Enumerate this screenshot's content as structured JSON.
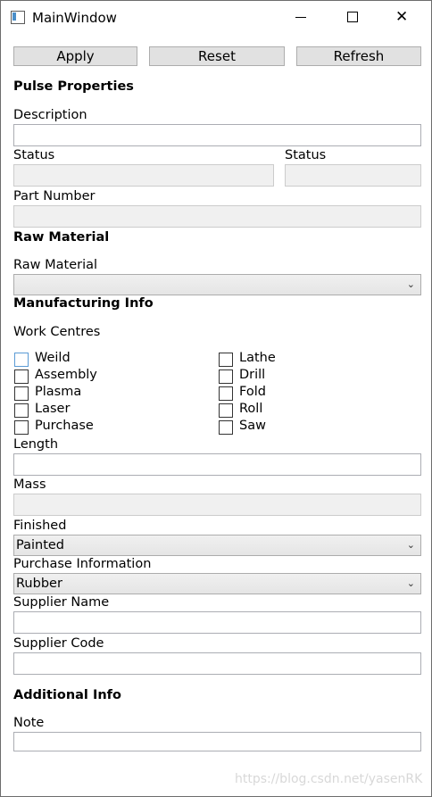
{
  "window": {
    "title": "MainWindow"
  },
  "toolbar": {
    "apply": "Apply",
    "reset": "Reset",
    "refresh": "Refresh"
  },
  "pulse": {
    "header": "Pulse Properties",
    "description_label": "Description",
    "description_value": "",
    "status_label_1": "Status",
    "status_label_2": "Status",
    "part_number_label": "Part Number"
  },
  "raw_material": {
    "header": "Raw Material",
    "label": "Raw Material",
    "selected": ""
  },
  "manufacturing": {
    "header": "Manufacturing Info",
    "work_centres_label": "Work Centres",
    "left_checkboxes": [
      {
        "label": "Weild",
        "checked": false
      },
      {
        "label": "Assembly",
        "checked": false
      },
      {
        "label": "Plasma",
        "checked": false
      },
      {
        "label": "Laser",
        "checked": false
      },
      {
        "label": "Purchase",
        "checked": false
      }
    ],
    "right_checkboxes": [
      {
        "label": "Lathe",
        "checked": false
      },
      {
        "label": "Drill",
        "checked": false
      },
      {
        "label": "Fold",
        "checked": false
      },
      {
        "label": "Roll",
        "checked": false
      },
      {
        "label": "Saw",
        "checked": false
      }
    ],
    "length_label": "Length",
    "mass_label": "Mass",
    "finished_label": "Finished",
    "finished_selected": "Painted",
    "purchase_info_label": "Purchase Information",
    "purchase_info_selected": "Rubber",
    "supplier_name_label": "Supplier Name",
    "supplier_code_label": "Supplier Code"
  },
  "additional": {
    "header": "Additional Info",
    "note_label": "Note"
  },
  "watermark": "https://blog.csdn.net/yasenRK",
  "icons": {
    "app": "window-app-icon",
    "minimize": "minimize-icon",
    "maximize": "maximize-icon",
    "close": "close-icon",
    "dropdown": "chevron-down-icon"
  }
}
